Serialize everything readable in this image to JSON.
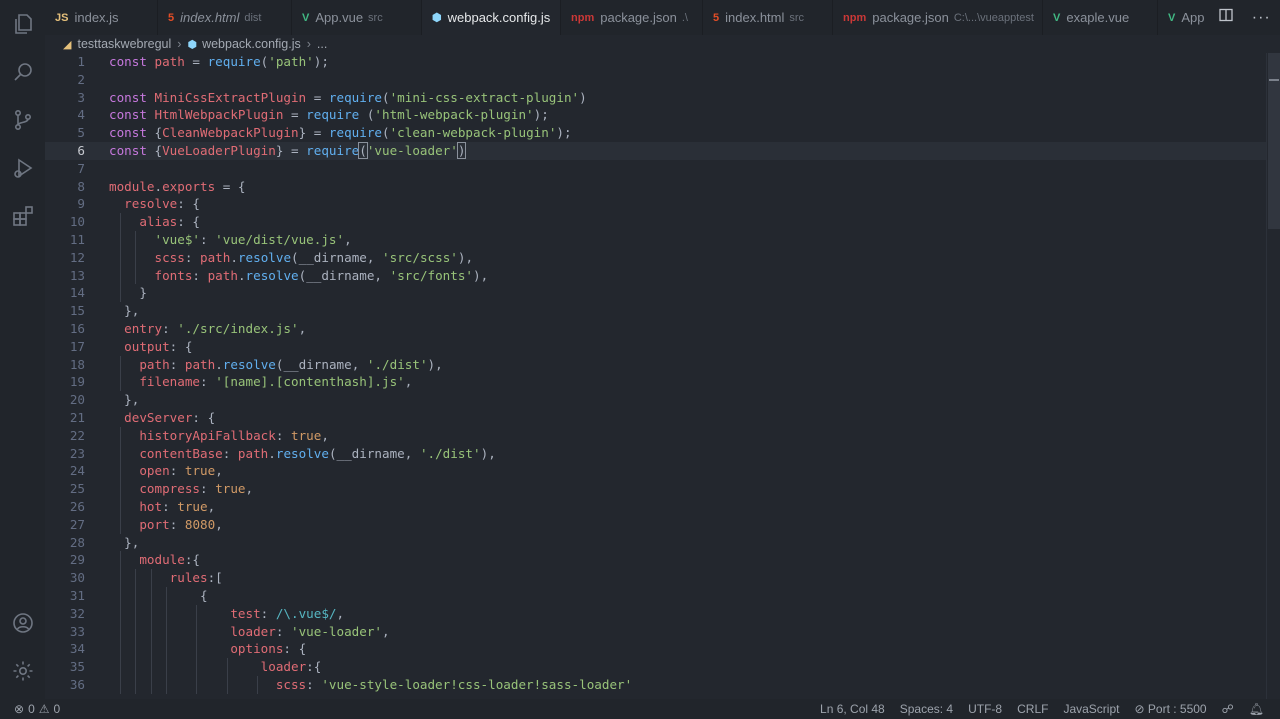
{
  "tabs": [
    {
      "icon": "js-file-icon",
      "glyph": "JS",
      "color": "#e5c07b",
      "name": "index.js",
      "desc": "",
      "italic": false,
      "active": false
    },
    {
      "icon": "html5-file-icon",
      "glyph": "5",
      "color": "#e44d26",
      "name": "index.html",
      "desc": "dist",
      "italic": true,
      "active": false
    },
    {
      "icon": "vue-file-icon",
      "glyph": "V",
      "color": "#41b883",
      "name": "App.vue",
      "desc": "src",
      "italic": false,
      "active": false
    },
    {
      "icon": "webpack-file-icon",
      "glyph": "⬢",
      "color": "#8ed6fb",
      "name": "webpack.config.js",
      "desc": "",
      "italic": false,
      "active": true
    },
    {
      "icon": "npm-file-icon",
      "glyph": "npm",
      "color": "#cb3837",
      "name": "package.json",
      "desc": ".\\",
      "italic": false,
      "active": false
    },
    {
      "icon": "html5-file-icon",
      "glyph": "5",
      "color": "#e44d26",
      "name": "index.html",
      "desc": "src",
      "italic": false,
      "active": false
    },
    {
      "icon": "npm-file-icon",
      "glyph": "npm",
      "color": "#cb3837",
      "name": "package.json",
      "desc": "C:\\...\\vueapptest",
      "italic": false,
      "active": false
    },
    {
      "icon": "vue-file-icon",
      "glyph": "V",
      "color": "#41b883",
      "name": "exaple.vue",
      "desc": "",
      "italic": false,
      "active": false
    },
    {
      "icon": "vue-file-icon",
      "glyph": "V",
      "color": "#41b883",
      "name": "App",
      "desc": "",
      "italic": false,
      "active": false
    }
  ],
  "breadcrumb": {
    "folder": "testtaskwebregul",
    "file": "webpack.config.js",
    "tail": "..."
  },
  "editor": {
    "current_line": 6,
    "lines": [
      [
        [
          "k",
          "const "
        ],
        [
          "v",
          "path"
        ],
        [
          "p",
          " = "
        ],
        [
          "f",
          "require"
        ],
        [
          "p",
          "("
        ],
        [
          "s",
          "'path'"
        ],
        [
          "p",
          ");"
        ]
      ],
      [],
      [
        [
          "k",
          "const "
        ],
        [
          "v",
          "MiniCssExtractPlugin"
        ],
        [
          "p",
          " = "
        ],
        [
          "f",
          "require"
        ],
        [
          "p",
          "("
        ],
        [
          "s",
          "'mini-css-extract-plugin'"
        ],
        [
          "p",
          ")"
        ]
      ],
      [
        [
          "k",
          "const "
        ],
        [
          "v",
          "HtmlWebpackPlugin"
        ],
        [
          "p",
          " = "
        ],
        [
          "f",
          "require"
        ],
        [
          "p",
          " ("
        ],
        [
          "s",
          "'html-webpack-plugin'"
        ],
        [
          "p",
          ");"
        ]
      ],
      [
        [
          "k",
          "const "
        ],
        [
          "p",
          "{"
        ],
        [
          "v",
          "CleanWebpackPlugin"
        ],
        [
          "p",
          "} = "
        ],
        [
          "f",
          "require"
        ],
        [
          "p",
          "("
        ],
        [
          "s",
          "'clean-webpack-plugin'"
        ],
        [
          "p",
          ");"
        ]
      ],
      [
        [
          "k",
          "const "
        ],
        [
          "p",
          "{"
        ],
        [
          "v",
          "VueLoaderPlugin"
        ],
        [
          "p",
          "} = "
        ],
        [
          "f",
          "require"
        ],
        [
          "b",
          "("
        ],
        [
          "s",
          "'vue-loader'"
        ],
        [
          "b",
          ")"
        ]
      ],
      [],
      [
        [
          "v",
          "module"
        ],
        [
          "p",
          "."
        ],
        [
          "v",
          "exports"
        ],
        [
          "p",
          " = {"
        ]
      ],
      [
        [
          "p",
          "  "
        ],
        [
          "v",
          "resolve"
        ],
        [
          "p",
          ": {"
        ]
      ],
      [
        [
          "p",
          "    "
        ],
        [
          "v",
          "alias"
        ],
        [
          "p",
          ": {"
        ]
      ],
      [
        [
          "p",
          "      "
        ],
        [
          "s",
          "'vue$'"
        ],
        [
          "p",
          ": "
        ],
        [
          "s",
          "'vue/dist/vue.js'"
        ],
        [
          "p",
          ","
        ]
      ],
      [
        [
          "p",
          "      "
        ],
        [
          "v",
          "scss"
        ],
        [
          "p",
          ": "
        ],
        [
          "v",
          "path"
        ],
        [
          "p",
          "."
        ],
        [
          "f",
          "resolve"
        ],
        [
          "p",
          "(__dirname, "
        ],
        [
          "s",
          "'src/scss'"
        ],
        [
          "p",
          "),"
        ]
      ],
      [
        [
          "p",
          "      "
        ],
        [
          "v",
          "fonts"
        ],
        [
          "p",
          ": "
        ],
        [
          "v",
          "path"
        ],
        [
          "p",
          "."
        ],
        [
          "f",
          "resolve"
        ],
        [
          "p",
          "(__dirname, "
        ],
        [
          "s",
          "'src/fonts'"
        ],
        [
          "p",
          "),"
        ]
      ],
      [
        [
          "p",
          "    }"
        ]
      ],
      [
        [
          "p",
          "  },"
        ]
      ],
      [
        [
          "p",
          "  "
        ],
        [
          "v",
          "entry"
        ],
        [
          "p",
          ": "
        ],
        [
          "s",
          "'./src/index.js'"
        ],
        [
          "p",
          ","
        ]
      ],
      [
        [
          "p",
          "  "
        ],
        [
          "v",
          "output"
        ],
        [
          "p",
          ": {"
        ]
      ],
      [
        [
          "p",
          "    "
        ],
        [
          "v",
          "path"
        ],
        [
          "p",
          ": "
        ],
        [
          "v",
          "path"
        ],
        [
          "p",
          "."
        ],
        [
          "f",
          "resolve"
        ],
        [
          "p",
          "(__dirname, "
        ],
        [
          "s",
          "'./dist'"
        ],
        [
          "p",
          "),"
        ]
      ],
      [
        [
          "p",
          "    "
        ],
        [
          "v",
          "filename"
        ],
        [
          "p",
          ": "
        ],
        [
          "s",
          "'[name].[contenthash].js'"
        ],
        [
          "p",
          ","
        ]
      ],
      [
        [
          "p",
          "  },"
        ]
      ],
      [
        [
          "p",
          "  "
        ],
        [
          "v",
          "devServer"
        ],
        [
          "p",
          ": {"
        ]
      ],
      [
        [
          "p",
          "    "
        ],
        [
          "v",
          "historyApiFallback"
        ],
        [
          "p",
          ": "
        ],
        [
          "n",
          "true"
        ],
        [
          "p",
          ","
        ]
      ],
      [
        [
          "p",
          "    "
        ],
        [
          "v",
          "contentBase"
        ],
        [
          "p",
          ": "
        ],
        [
          "v",
          "path"
        ],
        [
          "p",
          "."
        ],
        [
          "f",
          "resolve"
        ],
        [
          "p",
          "(__dirname, "
        ],
        [
          "s",
          "'./dist'"
        ],
        [
          "p",
          "),"
        ]
      ],
      [
        [
          "p",
          "    "
        ],
        [
          "v",
          "open"
        ],
        [
          "p",
          ": "
        ],
        [
          "n",
          "true"
        ],
        [
          "p",
          ","
        ]
      ],
      [
        [
          "p",
          "    "
        ],
        [
          "v",
          "compress"
        ],
        [
          "p",
          ": "
        ],
        [
          "n",
          "true"
        ],
        [
          "p",
          ","
        ]
      ],
      [
        [
          "p",
          "    "
        ],
        [
          "v",
          "hot"
        ],
        [
          "p",
          ": "
        ],
        [
          "n",
          "true"
        ],
        [
          "p",
          ","
        ]
      ],
      [
        [
          "p",
          "    "
        ],
        [
          "v",
          "port"
        ],
        [
          "p",
          ": "
        ],
        [
          "n",
          "8080"
        ],
        [
          "p",
          ","
        ]
      ],
      [
        [
          "p",
          "  },"
        ]
      ],
      [
        [
          "p",
          "    "
        ],
        [
          "v",
          "module"
        ],
        [
          "p",
          ":{"
        ]
      ],
      [
        [
          "p",
          "        "
        ],
        [
          "v",
          "rules"
        ],
        [
          "p",
          ":["
        ]
      ],
      [
        [
          "p",
          "            {"
        ]
      ],
      [
        [
          "p",
          "                "
        ],
        [
          "v",
          "test"
        ],
        [
          "p",
          ": "
        ],
        [
          "c",
          "/\\.vue$/"
        ],
        [
          "p",
          ","
        ]
      ],
      [
        [
          "p",
          "                "
        ],
        [
          "v",
          "loader"
        ],
        [
          "p",
          ": "
        ],
        [
          "s",
          "'vue-loader'"
        ],
        [
          "p",
          ","
        ]
      ],
      [
        [
          "p",
          "                "
        ],
        [
          "v",
          "options"
        ],
        [
          "p",
          ": {"
        ]
      ],
      [
        [
          "p",
          "                    "
        ],
        [
          "v",
          "loader"
        ],
        [
          "p",
          ":{"
        ]
      ],
      [
        [
          "p",
          "                      "
        ],
        [
          "v",
          "scss"
        ],
        [
          "p",
          ": "
        ],
        [
          "s",
          "'vue-style-loader!css-loader!sass-loader'"
        ]
      ]
    ]
  },
  "status": {
    "errors": "0",
    "warnings": "0",
    "position": "Ln 6, Col 48",
    "spaces": "Spaces: 4",
    "encoding": "UTF-8",
    "eol": "CRLF",
    "language": "JavaScript",
    "port": "Port : 5500"
  }
}
